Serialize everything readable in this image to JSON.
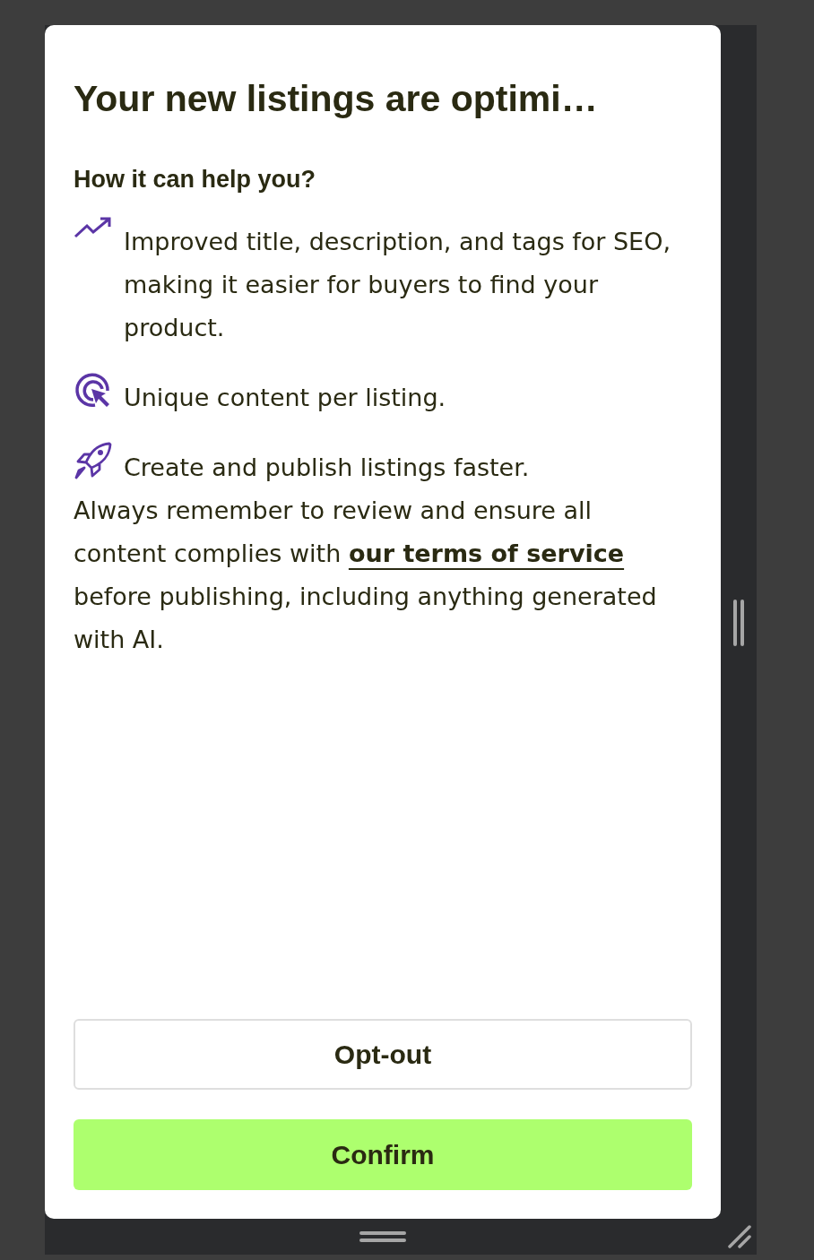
{
  "dialog": {
    "title": "Your new listings are optimi…",
    "subtitle": "How it can help you?",
    "benefits": [
      {
        "kind": "trend",
        "text": "Improved title, description, and tags for SEO, making it easier for buyers to find your product."
      },
      {
        "kind": "target",
        "text": "Unique content per listing."
      },
      {
        "kind": "rocket",
        "text": "Create and publish listings faster."
      }
    ],
    "notice": {
      "before": "Always remember to review and ensure all content complies with",
      "link": "our terms of service",
      "after": "before publishing, including anything generated with AI."
    },
    "buttons": [
      {
        "kind": "secondary",
        "label": "Opt-out"
      },
      {
        "kind": "primary",
        "label": "Confirm"
      }
    ]
  }
}
